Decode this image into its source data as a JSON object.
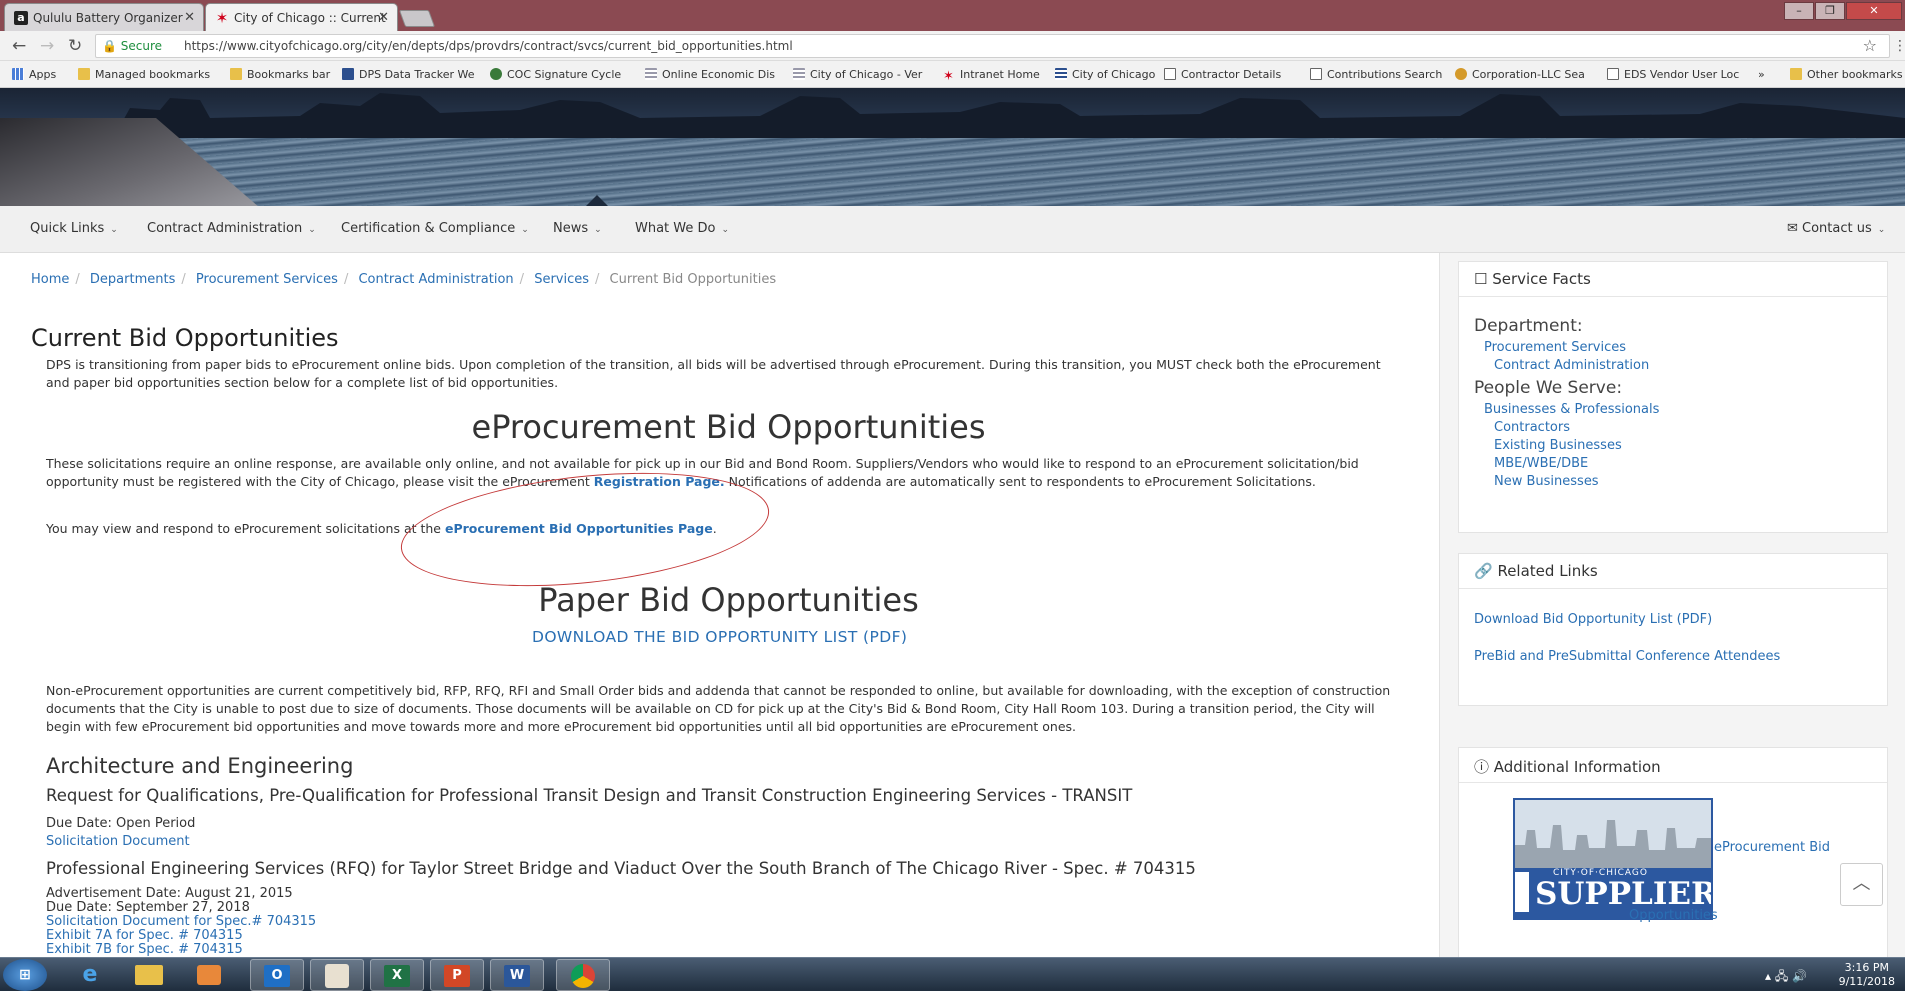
{
  "browser": {
    "tabs": [
      {
        "label": "Qululu Battery Organizer",
        "favicon": "a"
      },
      {
        "label": "City of Chicago :: Current",
        "favicon": "✶"
      }
    ],
    "secure_label": "Secure",
    "url": "https://www.cityofchicago.org/city/en/depts/dps/provdrs/contract/svcs/current_bid_opportunities.html",
    "bookmarks": [
      "Apps",
      "Managed bookmarks",
      "Bookmarks bar",
      "DPS Data Tracker We",
      "COC Signature Cycle",
      "Online Economic Dis",
      "City of Chicago - Ver",
      "Intranet Home",
      "City of Chicago",
      "Contractor Details",
      "Contributions Search",
      "Corporation-LLC Sea",
      "EDS Vendor User Loc",
      "»",
      "Other bookmarks"
    ]
  },
  "nav": {
    "items": [
      "Quick Links",
      "Contract Administration",
      "Certification & Compliance",
      "News",
      "What We Do"
    ],
    "contact": "Contact us"
  },
  "breadcrumb": [
    "Home",
    "Departments",
    "Procurement Services",
    "Contract Administration",
    "Services",
    "Current Bid Opportunities"
  ],
  "main": {
    "title": "Current Bid Opportunities",
    "intro": "DPS is transitioning from paper bids to eProcurement online bids.  Upon completion of the transition, all bids will be advertised through eProcurement.  During this transition, you MUST check both the eProcurement and paper bid opportunities section below for a complete list of bid opportunities.",
    "eproc_heading": "eProcurement Bid Opportunities",
    "eproc_text_before": "These solicitations require an online response, are available only online, and not available for pick up in our Bid and Bond Room.  Suppliers/Vendors who would like to respond to an eProcurement solicitation/bid opportunity must be registered with the City of Chicago, please visit the eProcurement ",
    "eproc_reg_link": "Registration Page.",
    "eproc_text_after": " Notifications of addenda are automatically sent to respondents to eProcurement Solicitations.",
    "eproc_view_text": "You may view and respond to eProcurement solicitations at the ",
    "eproc_view_link": "eProcurement Bid Opportunities Page",
    "eproc_view_end": ".",
    "paper_heading": "Paper Bid Opportunities",
    "paper_download": "DOWNLOAD THE BID OPPORTUNITY LIST (PDF)",
    "paper_text": "Non-eProcurement opportunities are current competitively bid, RFP, RFQ, RFI and Small Order bids and addenda that cannot be responded to online, but available for downloading, with the exception of construction documents that the City is unable to post due to size of documents.  Those documents will be available on CD for pick up  at the City's Bid & Bond Room, City Hall Room 103. During a transition period, the City will begin with few eProcurement bid opportunities and move towards more and more eProcurement bid opportunities until all bid opportunities are eProcurement ones.",
    "section": "Architecture and Engineering",
    "item1_title": "Request for Qualifications, Pre-Qualification for Professional Transit Design and Transit Construction Engineering Services - TRANSIT",
    "item1_due": "Due Date: Open Period",
    "item1_doc": "Solicitation Document",
    "item2_title": "Professional Engineering Services (RFQ) for Taylor Street Bridge and Viaduct Over the South Branch of The Chicago River - Spec. # 704315",
    "item2_adv": "Advertisement Date:  August 21, 2015",
    "item2_due": "Due Date:  September 27, 2018",
    "item2_doc": "Solicitation Document for Spec.# 704315",
    "item2_ex7a": "Exhibit 7A for Spec. # 704315",
    "item2_ex7b": "Exhibit 7B for Spec. # 704315"
  },
  "sidebar": {
    "service_facts": "Service Facts",
    "department_label": "Department:",
    "dept_links": [
      "Procurement Services",
      "Contract Administration"
    ],
    "people_label": "People We Serve:",
    "people_links": [
      "Businesses & Professionals",
      "Contractors",
      "Existing Businesses",
      "MBE/WBE/DBE",
      "New Businesses"
    ],
    "related_links": "Related Links",
    "related": [
      "Download Bid Opportunity List (PDF)",
      "PreBid and PreSubmittal Conference Attendees"
    ],
    "additional_info": "Additional Information",
    "logo_top": "CITY·OF·CHICAGO",
    "logo_main": "SUPPLIER",
    "eproc_bid": "eProcurement Bid",
    "opportunities": "Opportunities"
  },
  "taskbar": {
    "time": "3:16 PM",
    "date": "9/11/2018"
  },
  "colors": {
    "link": "#2a6fb3",
    "annotation": "#c43a3a",
    "tabstrip": "#8b4a52"
  }
}
